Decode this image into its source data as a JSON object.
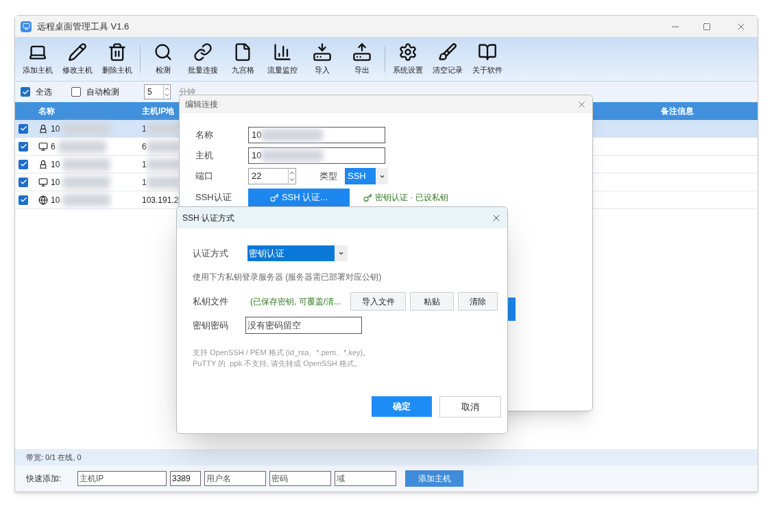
{
  "window": {
    "title": "远程桌面管理工具 V1.6"
  },
  "toolbar_groups": [
    [
      {
        "label": "添加主机",
        "kind": "laptop"
      },
      {
        "label": "修改主机",
        "kind": "pencil"
      },
      {
        "label": "删除主机",
        "kind": "trash"
      }
    ],
    [
      {
        "label": "检测",
        "kind": "search"
      },
      {
        "label": "批量连接",
        "kind": "link"
      },
      {
        "label": "九宫格",
        "kind": "file"
      },
      {
        "label": "流量监控",
        "kind": "chart"
      },
      {
        "label": "导入",
        "kind": "download"
      },
      {
        "label": "导出",
        "kind": "upload"
      }
    ],
    [
      {
        "label": "系统设置",
        "kind": "gear"
      },
      {
        "label": "清空记录",
        "kind": "brush"
      },
      {
        "label": "关于软件",
        "kind": "book"
      }
    ]
  ],
  "options": {
    "select_all": {
      "label": "全选",
      "checked": true
    },
    "auto_check": {
      "label": "自动检测",
      "checked": false
    },
    "interval": {
      "value": "5",
      "unit": "分钟"
    }
  },
  "table": {
    "columns": [
      "名称",
      "主机IP地",
      "备注信息"
    ],
    "rows": [
      {
        "checked": true,
        "selected": true,
        "kind": "linux",
        "name": "10",
        "ip": "1"
      },
      {
        "checked": true,
        "selected": false,
        "kind": "monitor",
        "name": "6",
        "ip": "6"
      },
      {
        "checked": true,
        "selected": false,
        "kind": "linux",
        "name": "10",
        "ip": "1"
      },
      {
        "checked": true,
        "selected": false,
        "kind": "monitor",
        "name": "10",
        "ip": "1"
      },
      {
        "checked": true,
        "selected": false,
        "kind": "globe",
        "name": "10",
        "ip": "103.191.2"
      }
    ]
  },
  "status_bar": "带宽: 0/1 在线, 0",
  "quick_add": {
    "label": "快速添加:",
    "fields": [
      {
        "placeholder": "主机IP"
      },
      {
        "value": "3389"
      },
      {
        "placeholder": "用户名"
      },
      {
        "placeholder": "密码"
      },
      {
        "placeholder": "域"
      }
    ],
    "button": "添加主机"
  },
  "edit_dialog": {
    "title": "编辑连接",
    "name_label": "名称",
    "name_value": "10",
    "host_label": "主机",
    "host_value": "10",
    "port_label": "端口",
    "port_value": "22",
    "type_label": "类型",
    "type_value": "SSH",
    "auth_label": "SSH认证",
    "auth_button": "SSH 认证...",
    "auth_status": "密钥认证 · 已设私钥"
  },
  "ssh_dialog": {
    "title": "SSH 认证方式",
    "method_label": "认证方式",
    "method_value": "密钥认证",
    "description": "使用下方私钥登录服务器 (服务器需已部署对应公钥)",
    "key_label": "私钥文件",
    "key_status": "(已保存密钥, 可覆盖/清...",
    "key_buttons": [
      "导入文件",
      "粘贴",
      "清除"
    ],
    "pass_label": "密钥密码",
    "pass_placeholder": "没有密码留空",
    "notes": [
      "支持 OpenSSH / PEM 格式 (id_rsa、*.pem、*.key)。",
      "PuTTY 的 .ppk 不支持, 请先转成 OpenSSH 格式。"
    ],
    "ok": "确定",
    "cancel": "取消"
  }
}
